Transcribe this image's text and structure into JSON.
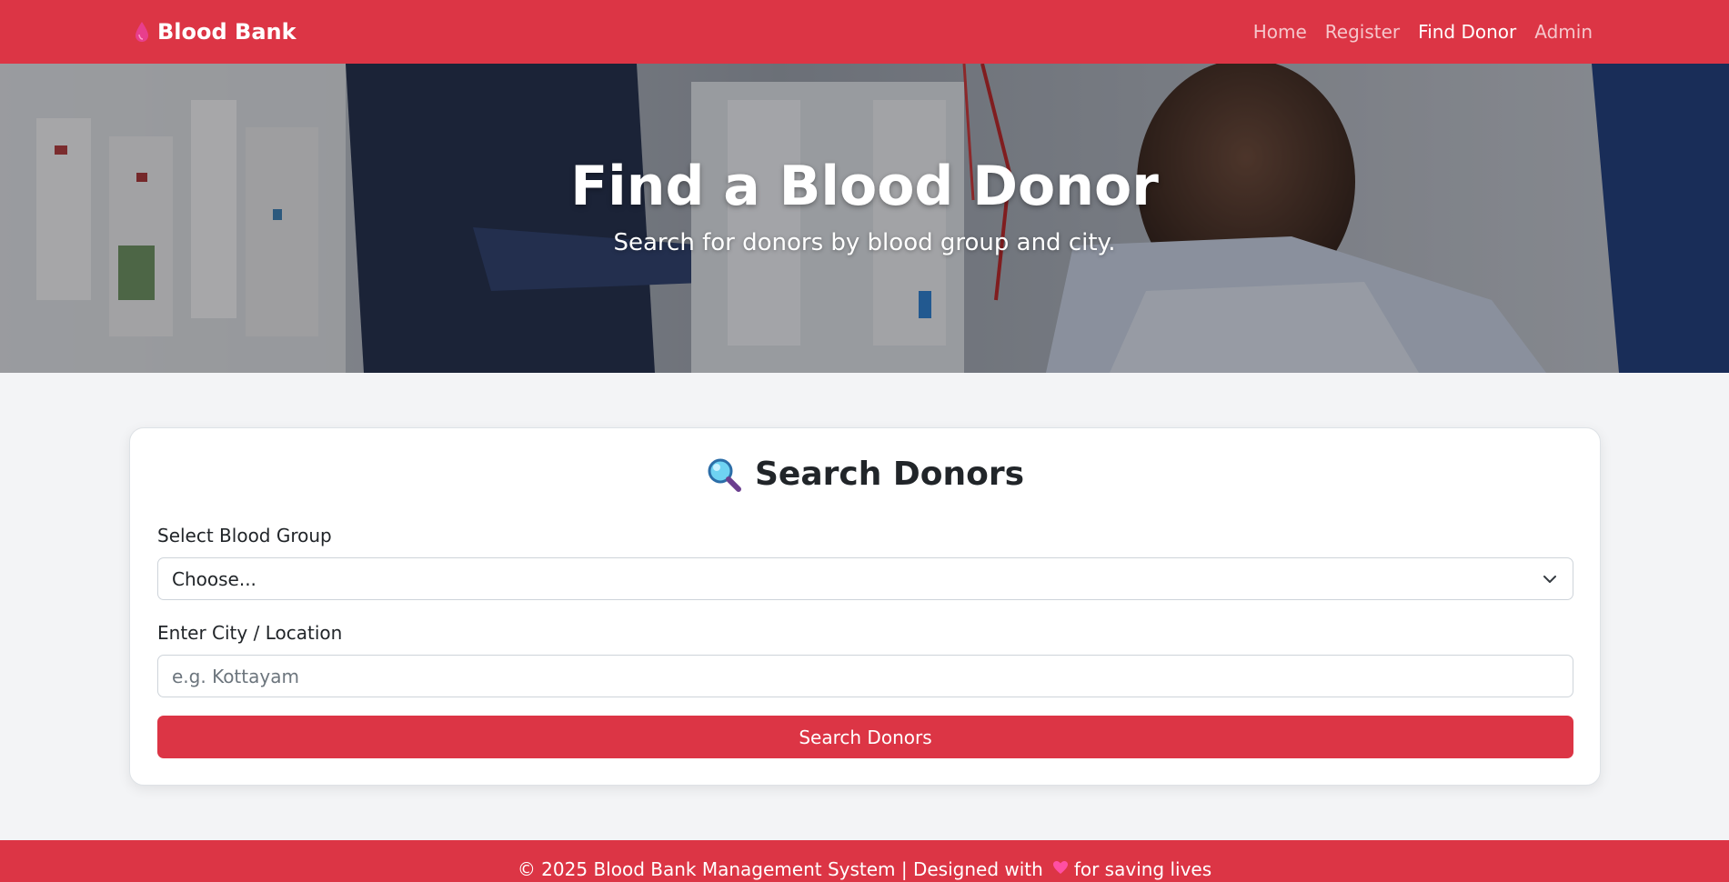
{
  "navbar": {
    "brand": "Blood Bank",
    "brand_icon": "blood-drop-icon",
    "links": [
      {
        "label": "Home",
        "active": false
      },
      {
        "label": "Register",
        "active": false
      },
      {
        "label": "Find Donor",
        "active": true
      },
      {
        "label": "Admin",
        "active": false
      }
    ]
  },
  "hero": {
    "title": "Find a Blood Donor",
    "subtitle": "Search for donors by blood group and city."
  },
  "search_card": {
    "title": "Search Donors",
    "title_icon": "magnifier-icon",
    "blood_group_label": "Select Blood Group",
    "blood_group_selected": "Choose...",
    "city_label": "Enter City / Location",
    "city_placeholder": "e.g. Kottayam",
    "city_value": "",
    "button_label": "Search Donors"
  },
  "footer": {
    "text_before": "© 2025 Blood Bank Management System | Designed with",
    "text_after": "for saving lives",
    "heart_icon": "heart-icon"
  },
  "colors": {
    "brand_red": "#dc3545",
    "page_bg": "#f3f4f6"
  }
}
